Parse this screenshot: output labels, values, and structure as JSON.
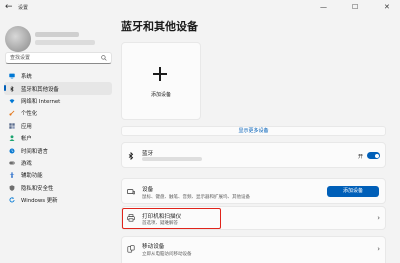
{
  "window": {
    "title": "设置",
    "back_glyph": "←",
    "minimize_glyph": "—",
    "maximize_glyph": "☐",
    "close_glyph": "✕"
  },
  "search": {
    "placeholder": "查找设置"
  },
  "sidebar": {
    "items": [
      {
        "label": "系统",
        "icon": "monitor-icon",
        "color": "#0078d4",
        "active": false
      },
      {
        "label": "蓝牙和其他设备",
        "icon": "bluetooth-icon",
        "color": "#1b1b1b",
        "active": true
      },
      {
        "label": "网络和 Internet",
        "icon": "wifi-icon",
        "color": "#0078d4",
        "active": false
      },
      {
        "label": "个性化",
        "icon": "brush-icon",
        "color": "#e3761a",
        "active": false
      },
      {
        "label": "应用",
        "icon": "apps-icon",
        "color": "#5a6b8c",
        "active": false
      },
      {
        "label": "帐户",
        "icon": "account-icon",
        "color": "#1aa36f",
        "active": false
      },
      {
        "label": "时间和语言",
        "icon": "clock-globe-icon",
        "color": "#0a7ad1",
        "active": false
      },
      {
        "label": "游戏",
        "icon": "gamepad-icon",
        "color": "#6e6e6e",
        "active": false
      },
      {
        "label": "辅助功能",
        "icon": "accessibility-icon",
        "color": "#2b6fcb",
        "active": false
      },
      {
        "label": "隐私和安全性",
        "icon": "shield-icon",
        "color": "#6e6e6e",
        "active": false
      },
      {
        "label": "Windows 更新",
        "icon": "update-icon",
        "color": "#0078d4",
        "active": false
      }
    ]
  },
  "main": {
    "title": "蓝牙和其他设备",
    "add_device_label": "添加设备",
    "show_more_label": "显示更多设备",
    "bluetooth": {
      "title": "蓝牙",
      "toggle_label": "开",
      "toggle_on": true
    },
    "devices": {
      "title": "设备",
      "subtitle": "鼠标、键盘、触笔、音频、显示器和扩展坞、其他设备",
      "button_label": "添加设备"
    },
    "printers": {
      "title": "打印机和扫描仪",
      "subtitle": "首选项、疑难解答"
    },
    "mobile": {
      "title": "移动设备",
      "subtitle": "立即从电脑访问移动设备"
    },
    "chevron_glyph": "›",
    "accent_color": "#005fb8",
    "highlight_color": "#e0241b"
  }
}
